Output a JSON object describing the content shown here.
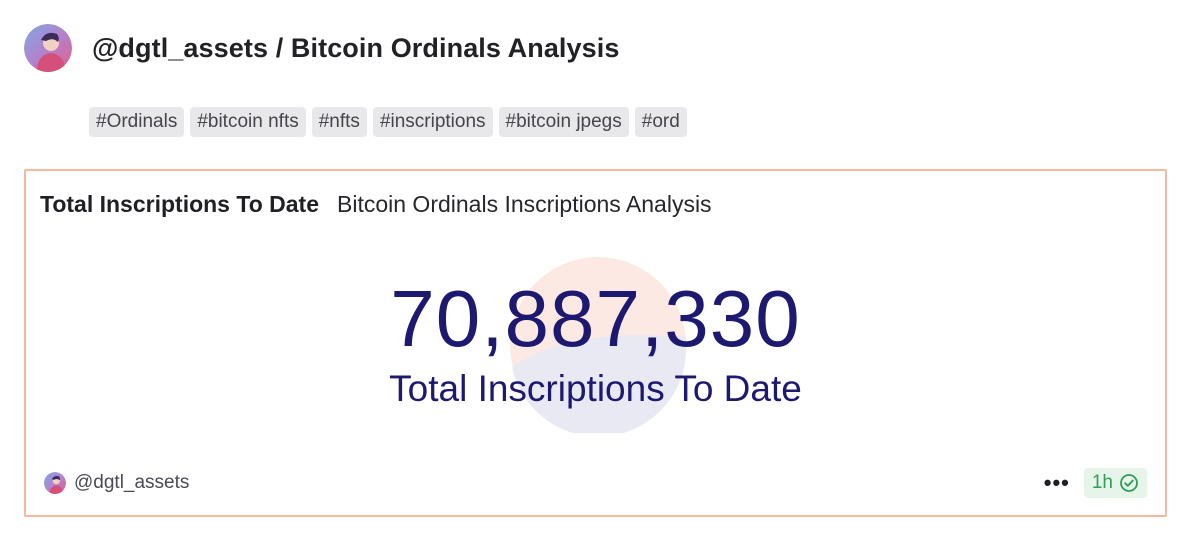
{
  "header": {
    "title": "@dgtl_assets / Bitcoin Ordinals Analysis",
    "avatar_icon": "profile-avatar"
  },
  "tags": [
    "#Ordinals",
    "#bitcoin nfts",
    "#nfts",
    "#inscriptions",
    "#bitcoin jpegs",
    "#ord"
  ],
  "card": {
    "title": "Total Inscriptions To Date",
    "subtitle": "Bitcoin Ordinals Inscriptions Analysis",
    "counter_value": "70,887,330",
    "counter_label": "Total Inscriptions To Date",
    "owner": "@dgtl_assets",
    "more_label": "•••",
    "refresh_age": "1h",
    "status_icon": "check-circle-icon",
    "colors": {
      "border": "#f0b9a0",
      "counter": "#1d1870",
      "status": "#2f9e57",
      "watermark_top": "#fde9e3",
      "watermark_bottom": "#e8e9f3"
    }
  }
}
